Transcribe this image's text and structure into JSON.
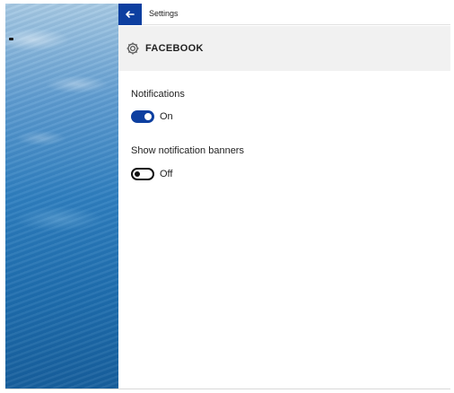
{
  "window": {
    "title": "Settings",
    "back_icon": "back-arrow-icon"
  },
  "wallpaper": {
    "description_colors": [
      "#a9cbe4",
      "#2f7fbf",
      "#175f9c"
    ]
  },
  "header": {
    "icon": "gear-icon",
    "title": "FACEBOOK"
  },
  "settings": [
    {
      "label": "Notifications",
      "state": "on",
      "state_label": "On"
    },
    {
      "label": "Show notification banners",
      "state": "off",
      "state_label": "Off"
    }
  ],
  "colors": {
    "accent": "#0d3fa0",
    "header_band": "#f1f1f1"
  }
}
